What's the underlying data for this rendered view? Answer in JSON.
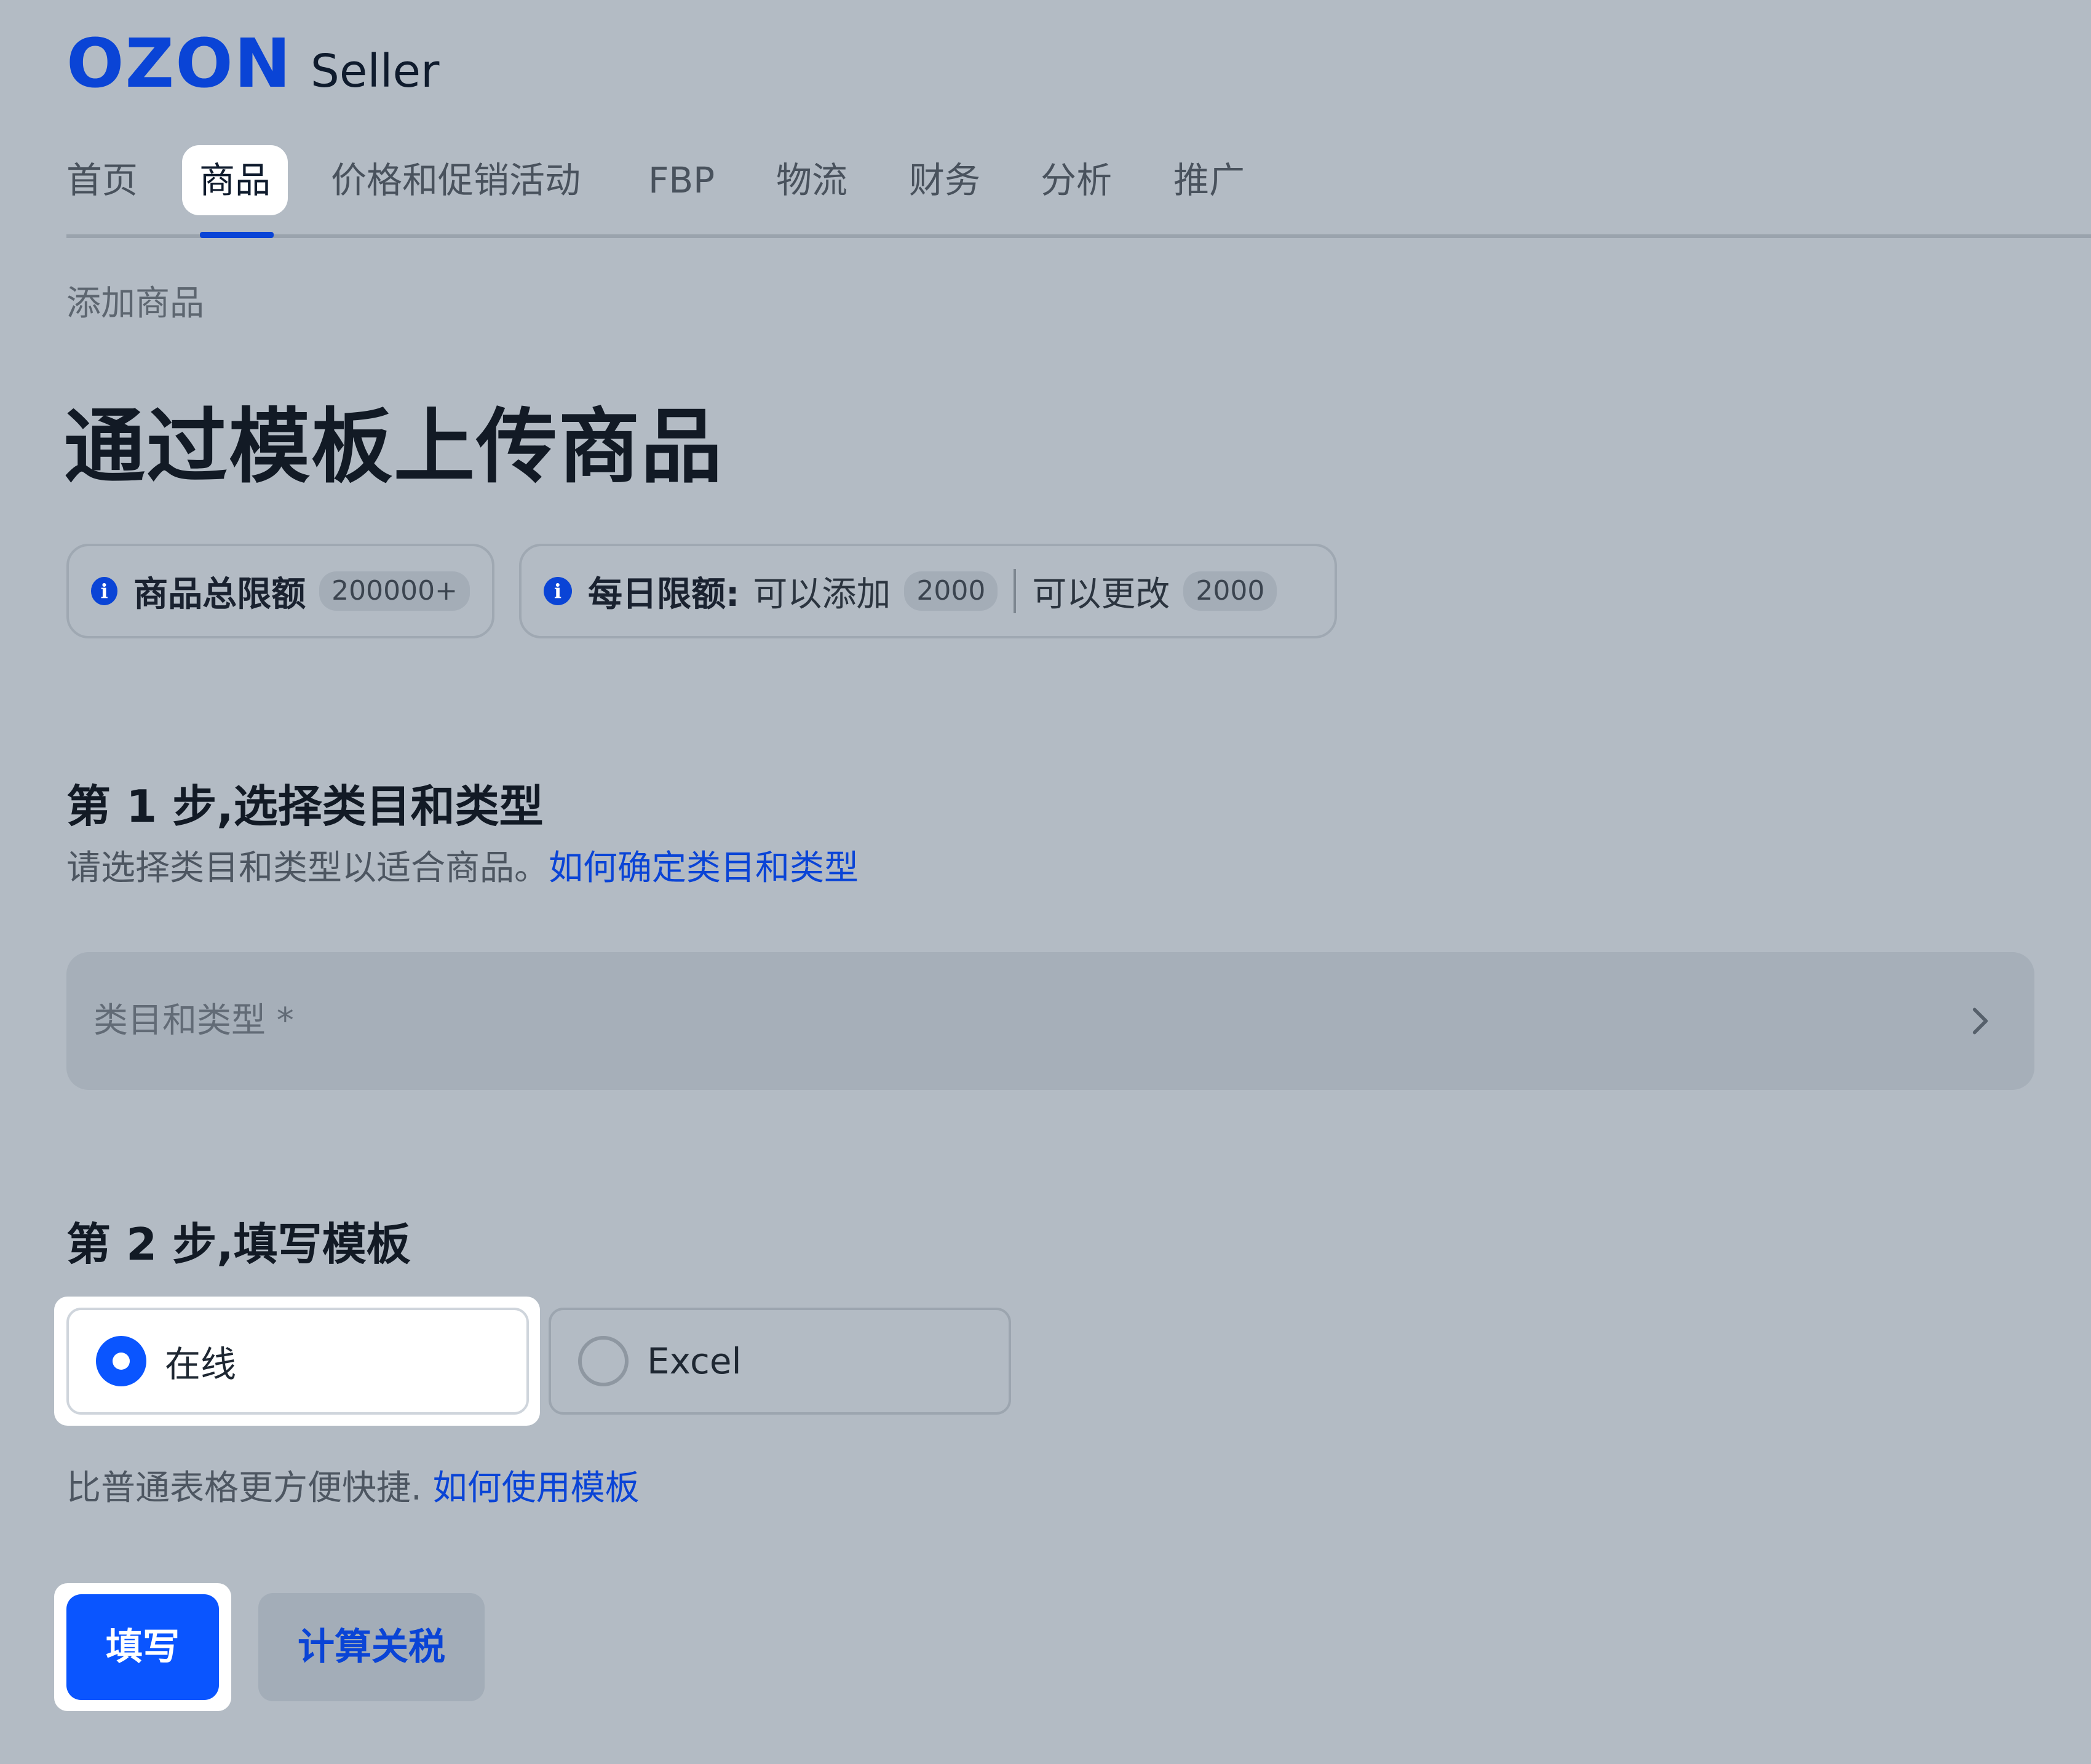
{
  "header": {
    "logo_brand": "OZON",
    "logo_product": "Seller"
  },
  "nav": {
    "items": [
      {
        "label": "首页"
      },
      {
        "label": "商品",
        "active": true
      },
      {
        "label": "价格和促销活动"
      },
      {
        "label": "FBP"
      },
      {
        "label": "物流"
      },
      {
        "label": "财务"
      },
      {
        "label": "分析"
      },
      {
        "label": "推广"
      }
    ]
  },
  "breadcrumb": "添加商品",
  "page_title": "通过模板上传商品",
  "limits": {
    "total": {
      "label": "商品总限额",
      "value": "200000+"
    },
    "daily": {
      "label": "每日限额:",
      "add_label": "可以添加",
      "add_value": "2000",
      "edit_label": "可以更改",
      "edit_value": "2000"
    }
  },
  "step1": {
    "title": "第 1 步,选择类目和类型",
    "description": "请选择类目和类型以适合商品。",
    "help_link": "如何确定类目和类型",
    "field_placeholder": "类目和类型 *"
  },
  "step2": {
    "title": "第 2 步,填写模板",
    "options": [
      {
        "label": "在线",
        "selected": true
      },
      {
        "label": "Excel",
        "selected": false
      }
    ],
    "description": "比普通表格更方便快捷.",
    "help_link": "如何使用模板"
  },
  "actions": {
    "fill_label": "填写",
    "calc_label": "计算关税"
  },
  "colors": {
    "accent": "#0a55ff",
    "brand": "#0a44d6",
    "background": "#b3bbc4"
  }
}
